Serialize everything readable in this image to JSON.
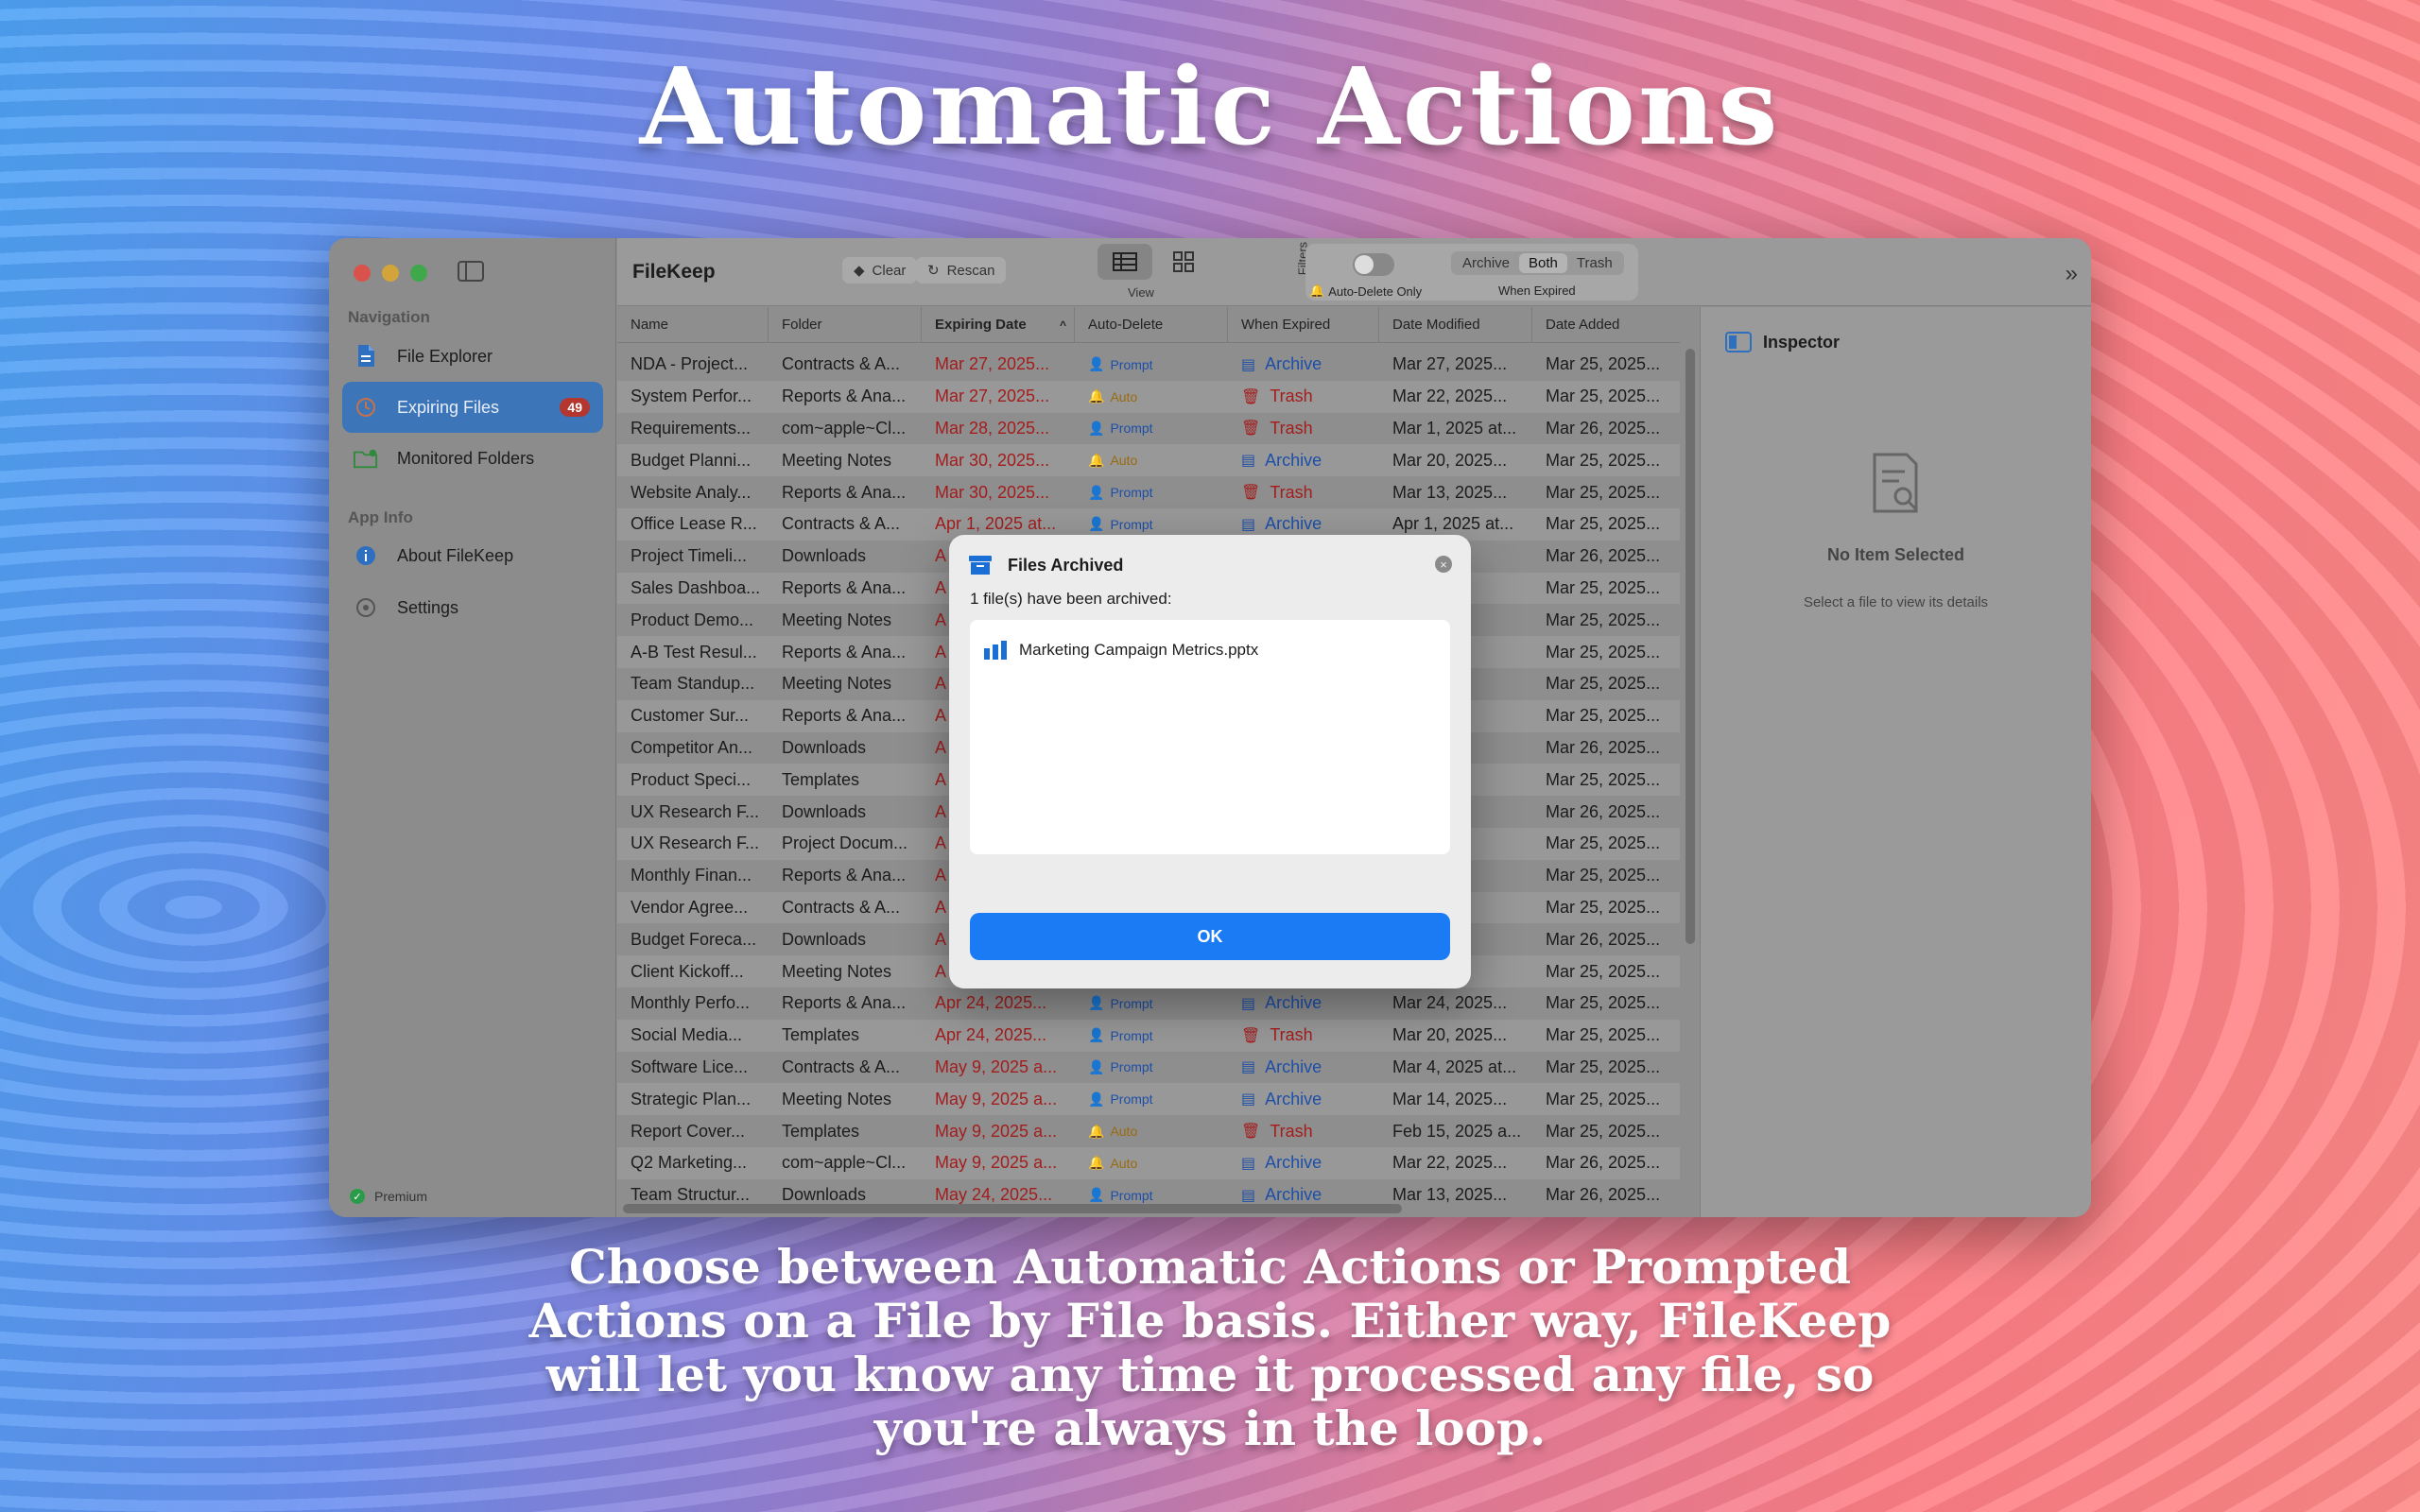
{
  "hero": {
    "title": "Automatic Actions",
    "subtitle": "Choose between Automatic Actions or Prompted Actions on a File by File basis. Either way, FileKeep will let you know any time it processed any file, so you're always in the loop."
  },
  "sidebar": {
    "nav_section": "Navigation",
    "items": [
      {
        "label": "File Explorer",
        "icon": "document-icon"
      },
      {
        "label": "Expiring Files",
        "icon": "timer-icon",
        "badge": "49"
      },
      {
        "label": "Monitored Folders",
        "icon": "folder-add-icon"
      }
    ],
    "info_section": "App Info",
    "info_items": [
      {
        "label": "About FileKeep",
        "icon": "info-icon"
      },
      {
        "label": "Settings",
        "icon": "gear-icon"
      }
    ],
    "premium": "Premium"
  },
  "toolbar": {
    "title": "FileKeep",
    "clear": "Clear",
    "rescan": "Rescan",
    "view_label": "View",
    "filters_label": "Filters",
    "auto_delete_only": "Auto-Delete Only",
    "segments": [
      "Archive",
      "Both",
      "Trash"
    ],
    "selected_segment": "Both",
    "when_expired_label": "When Expired"
  },
  "table": {
    "columns": [
      "Name",
      "Folder",
      "Expiring Date",
      "Auto-Delete",
      "When Expired",
      "Date Modified",
      "Date Added"
    ],
    "rows": [
      [
        "NDA - Project...",
        "Contracts & A...",
        "Mar 27, 2025...",
        "Prompt",
        "Archive",
        "Mar 27, 2025...",
        "Mar 25, 2025..."
      ],
      [
        "System Perfor...",
        "Reports & Ana...",
        "Mar 27, 2025...",
        "Auto",
        "Trash",
        "Mar 22, 2025...",
        "Mar 25, 2025..."
      ],
      [
        "Requirements...",
        "com~apple~Cl...",
        "Mar 28, 2025...",
        "Prompt",
        "Trash",
        "Mar 1, 2025 at...",
        "Mar 26, 2025..."
      ],
      [
        "Budget Planni...",
        "Meeting Notes",
        "Mar 30, 2025...",
        "Auto",
        "Archive",
        "Mar 20, 2025...",
        "Mar 25, 2025..."
      ],
      [
        "Website Analy...",
        "Reports & Ana...",
        "Mar 30, 2025...",
        "Prompt",
        "Trash",
        "Mar 13, 2025...",
        "Mar 25, 2025..."
      ],
      [
        "Office Lease R...",
        "Contracts & A...",
        "Apr 1, 2025 at...",
        "Prompt",
        "Archive",
        "Apr 1, 2025 at...",
        "Mar 25, 2025..."
      ],
      [
        "Project Timeli...",
        "Downloads",
        "A",
        "",
        "",
        "2025...",
        "Mar 26, 2025..."
      ],
      [
        "Sales Dashboa...",
        "Reports & Ana...",
        "A",
        "",
        "",
        "2025...",
        "Mar 25, 2025..."
      ],
      [
        "Product Demo...",
        "Meeting Notes",
        "A",
        "",
        "",
        "2025...",
        "Mar 25, 2025..."
      ],
      [
        "A-B Test Resul...",
        "Reports & Ana...",
        "A",
        "",
        "",
        "2025...",
        "Mar 25, 2025..."
      ],
      [
        "Team Standup...",
        "Meeting Notes",
        "A",
        "",
        "",
        "2025 a...",
        "Mar 25, 2025..."
      ],
      [
        "Customer Sur...",
        "Reports & Ana...",
        "A",
        "",
        "",
        "2025...",
        "Mar 25, 2025..."
      ],
      [
        "Competitor An...",
        "Downloads",
        "A",
        "",
        "",
        "2025...",
        "Mar 26, 2025..."
      ],
      [
        "Product Speci...",
        "Templates",
        "A",
        "",
        "",
        "2025 a...",
        "Mar 25, 2025..."
      ],
      [
        "UX Research F...",
        "Downloads",
        "A",
        "",
        "",
        "025 at...",
        "Mar 26, 2025..."
      ],
      [
        "UX Research F...",
        "Project Docum...",
        "A",
        "",
        "",
        "025 at...",
        "Mar 25, 2025..."
      ],
      [
        "Monthly Finan...",
        "Reports & Ana...",
        "A",
        "",
        "",
        "2025...",
        "Mar 25, 2025..."
      ],
      [
        "Vendor Agree...",
        "Contracts & A...",
        "A",
        "",
        "",
        "2025 a...",
        "Mar 25, 2025..."
      ],
      [
        "Budget Foreca...",
        "Downloads",
        "A",
        "",
        "",
        "2025...",
        "Mar 26, 2025..."
      ],
      [
        "Client Kickoff...",
        "Meeting Notes",
        "A",
        "",
        "",
        "025 at...",
        "Mar 25, 2025..."
      ],
      [
        "Monthly Perfo...",
        "Reports & Ana...",
        "Apr 24, 2025...",
        "Prompt",
        "Archive",
        "Mar 24, 2025...",
        "Mar 25, 2025..."
      ],
      [
        "Social Media...",
        "Templates",
        "Apr 24, 2025...",
        "Prompt",
        "Trash",
        "Mar 20, 2025...",
        "Mar 25, 2025..."
      ],
      [
        "Software Lice...",
        "Contracts & A...",
        "May 9, 2025 a...",
        "Prompt",
        "Archive",
        "Mar 4, 2025 at...",
        "Mar 25, 2025..."
      ],
      [
        "Strategic Plan...",
        "Meeting Notes",
        "May 9, 2025 a...",
        "Prompt",
        "Archive",
        "Mar 14, 2025...",
        "Mar 25, 2025..."
      ],
      [
        "Report Cover...",
        "Templates",
        "May 9, 2025 a...",
        "Auto",
        "Trash",
        "Feb 15, 2025 a...",
        "Mar 25, 2025..."
      ],
      [
        "Q2 Marketing...",
        "com~apple~Cl...",
        "May 9, 2025 a...",
        "Auto",
        "Archive",
        "Mar 22, 2025...",
        "Mar 26, 2025..."
      ],
      [
        "Team Structur...",
        "Downloads",
        "May 24, 2025...",
        "Prompt",
        "Archive",
        "Mar 13, 2025...",
        "Mar 26, 2025..."
      ]
    ]
  },
  "inspector": {
    "title": "Inspector",
    "empty_title": "No Item Selected",
    "empty_hint": "Select a file to view its details"
  },
  "modal": {
    "title": "Files Archived",
    "message": "1 file(s) have been archived:",
    "files": [
      "Marketing Campaign Metrics.pptx"
    ],
    "ok": "OK"
  },
  "colors": {
    "accent": "#1a7bf5",
    "expired": "#a31d1d",
    "archive": "#1d4fa8",
    "auto": "#9a6a10"
  }
}
